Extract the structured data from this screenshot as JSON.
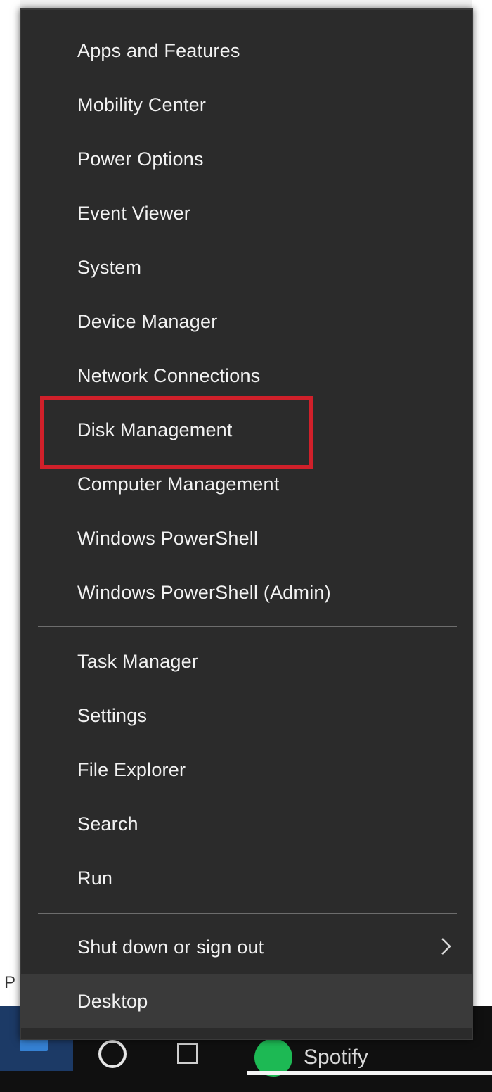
{
  "menu": {
    "group1": [
      {
        "label": "Apps and Features"
      },
      {
        "label": "Mobility Center"
      },
      {
        "label": "Power Options"
      },
      {
        "label": "Event Viewer"
      },
      {
        "label": "System"
      },
      {
        "label": "Device Manager"
      },
      {
        "label": "Network Connections"
      },
      {
        "label": "Disk Management"
      },
      {
        "label": "Computer Management"
      },
      {
        "label": "Windows PowerShell"
      },
      {
        "label": "Windows PowerShell (Admin)"
      }
    ],
    "group2": [
      {
        "label": "Task Manager"
      },
      {
        "label": "Settings"
      },
      {
        "label": "File Explorer"
      },
      {
        "label": "Search"
      },
      {
        "label": "Run"
      }
    ],
    "group3": [
      {
        "label": "Shut down or sign out",
        "icon": "chevron-right-icon"
      },
      {
        "label": "Desktop"
      }
    ],
    "highlighted_item": "Disk Management",
    "highlight_color": "#d0202a"
  },
  "background": {
    "left_partial_text": "P"
  },
  "taskbar": {
    "app_label": "Spotify",
    "app_color": "#1db954",
    "start_icon": "windows-start-icon",
    "search_icon": "search-icon",
    "taskview_icon": "task-view-icon"
  },
  "colors": {
    "menu_background": "#2b2b2b",
    "menu_text": "#f2f2f2",
    "separator": "#6d6d6d"
  }
}
